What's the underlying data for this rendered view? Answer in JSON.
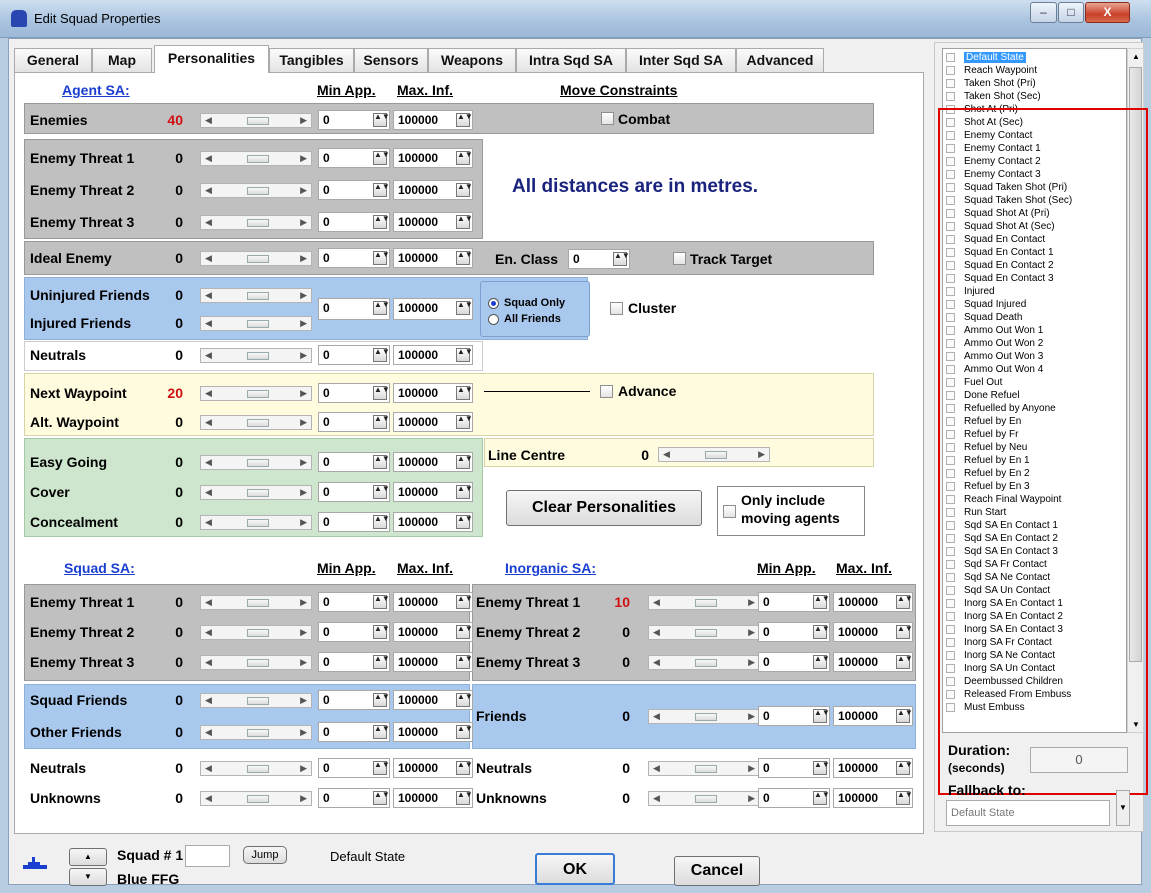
{
  "window": {
    "title": "Edit Squad Properties",
    "min": "–",
    "max": "□",
    "close": "X"
  },
  "tabs": [
    "General",
    "Map",
    "Personalities",
    "Tangibles",
    "Sensors",
    "Weapons",
    "Intra Sqd SA",
    "Inter Sqd SA",
    "Advanced"
  ],
  "active_tab": "Personalities",
  "agent_sa": {
    "title": "Agent SA:",
    "col_min": "Min App.",
    "col_max": "Max. Inf.",
    "move_constraints": "Move Constraints",
    "rows": [
      {
        "label": "Enemies",
        "value": "40",
        "min": "0",
        "max": "100000"
      },
      {
        "label": "Enemy Threat 1",
        "value": "0",
        "min": "0",
        "max": "100000"
      },
      {
        "label": "Enemy Threat 2",
        "value": "0",
        "min": "0",
        "max": "100000"
      },
      {
        "label": "Enemy Threat 3",
        "value": "0",
        "min": "0",
        "max": "100000"
      },
      {
        "label": "Ideal Enemy",
        "value": "0",
        "min": "0",
        "max": "100000"
      },
      {
        "label": "Uninjured Friends",
        "value": "0"
      },
      {
        "label": "Injured Friends",
        "value": "0"
      },
      {
        "label": "Neutrals",
        "value": "0",
        "min": "0",
        "max": "100000"
      },
      {
        "label": "Next Waypoint",
        "value": "20",
        "min": "0",
        "max": "100000"
      },
      {
        "label": "Alt. Waypoint",
        "value": "0",
        "min": "0",
        "max": "100000"
      },
      {
        "label": "Easy Going",
        "value": "0",
        "min": "0",
        "max": "100000"
      },
      {
        "label": "Cover",
        "value": "0",
        "min": "0",
        "max": "100000"
      },
      {
        "label": "Concealment",
        "value": "0",
        "min": "0",
        "max": "100000"
      }
    ],
    "friends_min": "0",
    "friends_max": "100000",
    "extra_min": "0",
    "extra_max": "100000",
    "combat": "Combat",
    "distance_note": "All distances are in metres.",
    "en_class_label": "En. Class",
    "en_class_value": "0",
    "track_target": "Track Target",
    "squad_only": "Squad Only",
    "all_friends": "All Friends",
    "cluster": "Cluster",
    "advance": "Advance",
    "line_centre": "Line Centre",
    "line_centre_value": "0",
    "clear_button": "Clear Personalities",
    "only_moving_line1": "Only include",
    "only_moving_line2": "moving agents"
  },
  "squad_sa": {
    "title": "Squad SA:",
    "col_min": "Min App.",
    "col_max": "Max. Inf.",
    "rows": [
      {
        "label": "Enemy Threat 1",
        "value": "0",
        "min": "0",
        "max": "100000"
      },
      {
        "label": "Enemy Threat 2",
        "value": "0",
        "min": "0",
        "max": "100000"
      },
      {
        "label": "Enemy Threat 3",
        "value": "0",
        "min": "0",
        "max": "100000"
      },
      {
        "label": "Squad Friends",
        "value": "0",
        "min": "0",
        "max": "100000"
      },
      {
        "label": "Other Friends",
        "value": "0",
        "min": "0",
        "max": "100000"
      },
      {
        "label": "Neutrals",
        "value": "0",
        "min": "0",
        "max": "100000"
      },
      {
        "label": "Unknowns",
        "value": "0",
        "min": "0",
        "max": "100000"
      }
    ]
  },
  "inorganic_sa": {
    "title": "Inorganic SA:",
    "col_min": "Min App.",
    "col_max": "Max. Inf.",
    "rows": [
      {
        "label": "Enemy Threat 1",
        "value": "10",
        "min": "0",
        "max": "100000"
      },
      {
        "label": "Enemy Threat 2",
        "value": "0",
        "min": "0",
        "max": "100000"
      },
      {
        "label": "Enemy Threat 3",
        "value": "0",
        "min": "0",
        "max": "100000"
      },
      {
        "label": "Friends",
        "value": "0",
        "min": "0",
        "max": "100000"
      },
      {
        "label": "Neutrals",
        "value": "0",
        "min": "0",
        "max": "100000"
      },
      {
        "label": "Unknowns",
        "value": "0",
        "min": "0",
        "max": "100000"
      }
    ]
  },
  "states": [
    "Default State",
    "Reach Waypoint",
    "Taken Shot (Pri)",
    "Taken Shot (Sec)",
    "Shot At (Pri)",
    "Shot At (Sec)",
    "Enemy Contact",
    "Enemy Contact 1",
    "Enemy Contact 2",
    "Enemy Contact 3",
    "Squad Taken Shot (Pri)",
    "Squad Taken Shot (Sec)",
    "Squad Shot At (Pri)",
    "Squad Shot At (Sec)",
    "Squad En Contact",
    "Squad En Contact 1",
    "Squad En Contact 2",
    "Squad En Contact 3",
    "Injured",
    "Squad Injured",
    "Squad Death",
    "Ammo Out Won 1",
    "Ammo Out Won 2",
    "Ammo Out Won 3",
    "Ammo Out Won 4",
    "Fuel Out",
    "Done Refuel",
    "Refuelled by Anyone",
    "Refuel by En",
    "Refuel by Fr",
    "Refuel by Neu",
    "Refuel by En 1",
    "Refuel by En 2",
    "Refuel by En 3",
    "Reach Final Waypoint",
    "Run Start",
    "Sqd SA En Contact 1",
    "Sqd SA En Contact 2",
    "Sqd SA En Contact 3",
    "Sqd SA Fr Contact",
    "Sqd SA Ne Contact",
    "Sqd SA Un Contact",
    "Inorg SA En Contact 1",
    "Inorg SA En Contact 2",
    "Inorg SA En Contact 3",
    "Inorg SA Fr Contact",
    "Inorg SA Ne Contact",
    "Inorg SA Un Contact",
    "Deembussed Children",
    "Released From Embuss",
    "Must Embuss"
  ],
  "duration": {
    "label1": "Duration:",
    "label2": "(seconds)",
    "value": "0"
  },
  "fallback": {
    "label": "Fallback to:",
    "value": "Default State"
  },
  "footer": {
    "squad_label": "Squad # 1",
    "jump": "Jump",
    "state": "Default State",
    "unit": "Blue FFG",
    "ok": "OK",
    "cancel": "Cancel"
  },
  "colors": {
    "grey": "#c0c0c0",
    "blue": "#a9c8ee",
    "yellow": "#fffbde",
    "green": "#cde6cd",
    "highlight_red": "#e00000"
  }
}
